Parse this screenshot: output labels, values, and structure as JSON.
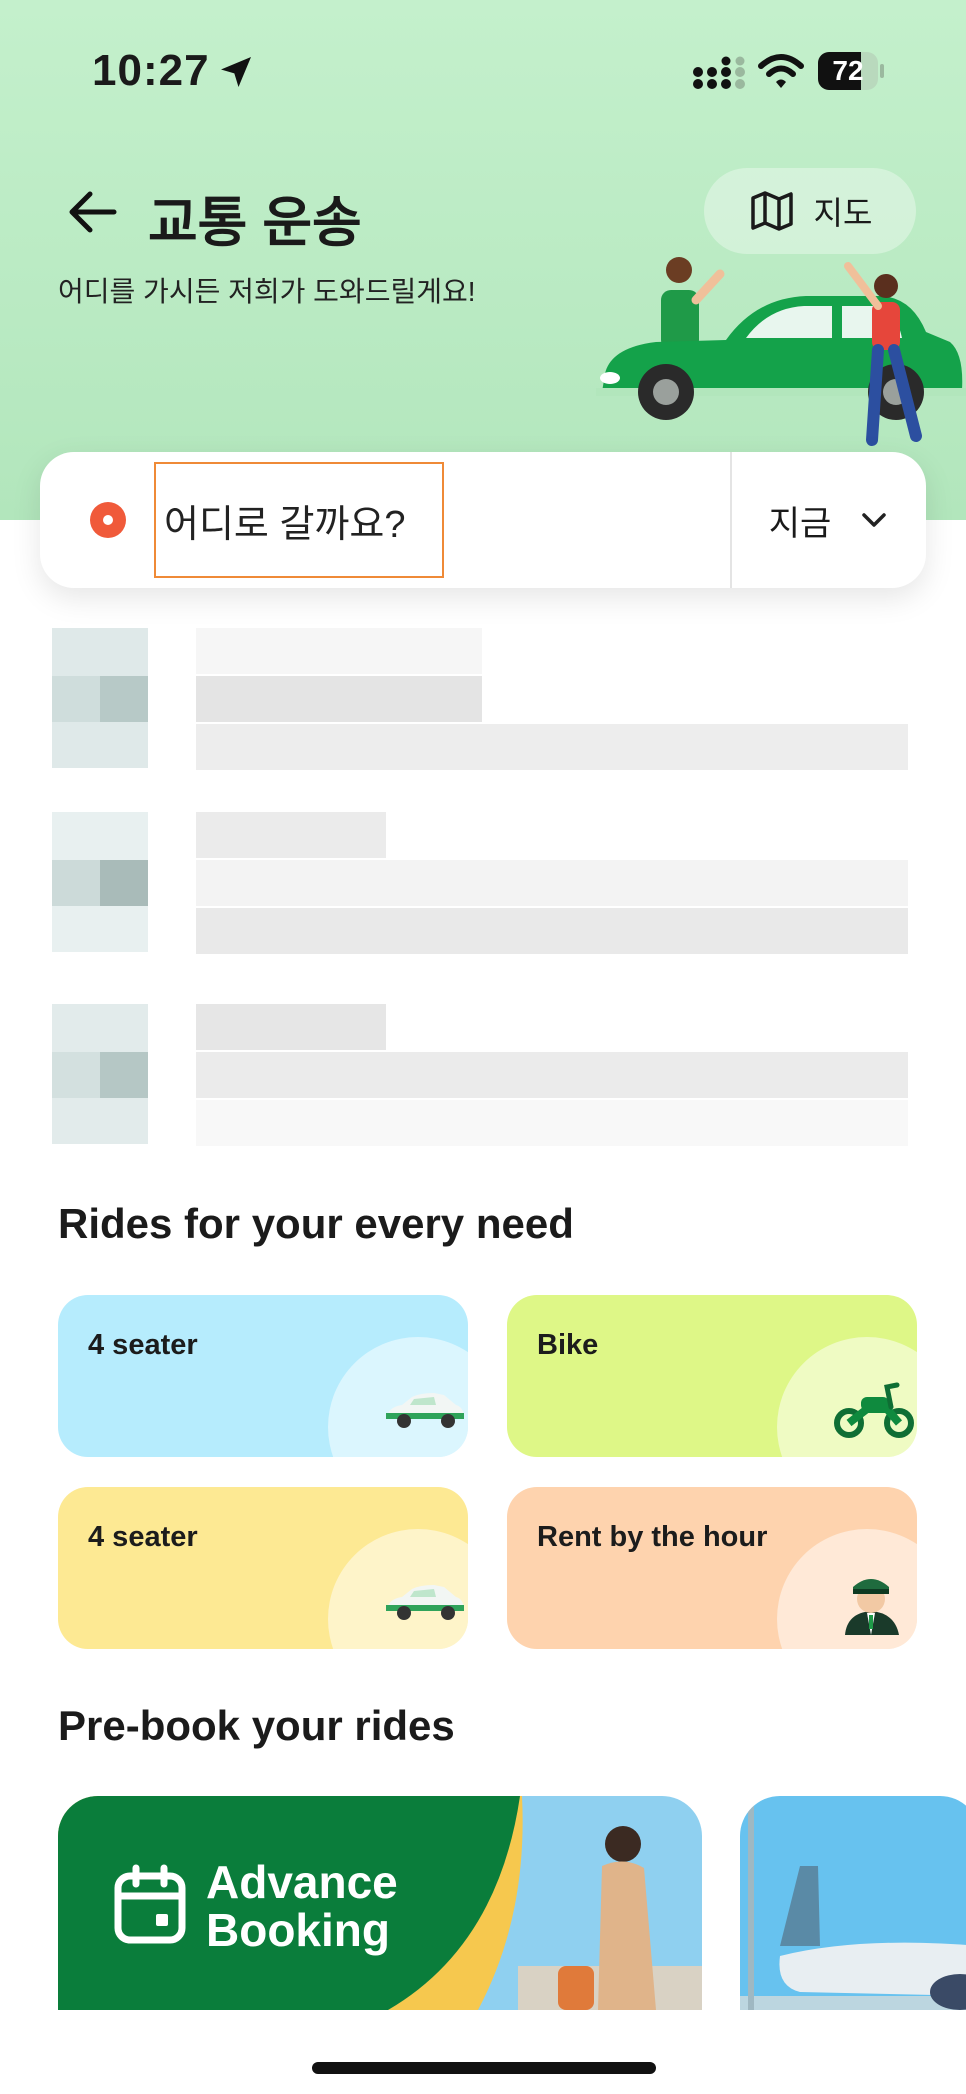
{
  "status_bar": {
    "time": "10:27",
    "battery": "72",
    "battery_level": 0.72
  },
  "header": {
    "title": "교통 운송",
    "subtitle": "어디를 가시든 저희가 도와드릴게요!",
    "map_button_label": "지도"
  },
  "search": {
    "placeholder": "어디로 갈까요?",
    "time_option": "지금"
  },
  "rides_section": {
    "title": "Rides for your every need",
    "options": [
      {
        "label": "4 seater",
        "color": "#b6ecfd",
        "icon": "car-icon"
      },
      {
        "label": "Bike",
        "color": "#def787",
        "icon": "scooter-icon"
      },
      {
        "label": "4 seater",
        "color": "#fde993",
        "icon": "car-icon"
      },
      {
        "label": "Rent by the hour",
        "color": "#fed3ae",
        "icon": "driver-icon"
      }
    ]
  },
  "prebook_section": {
    "title": "Pre-book your rides",
    "banner_line1": "Advance",
    "banner_line2": "Booking"
  },
  "colors": {
    "header_bg": "#c4f0cc",
    "accent_green": "#0a8a3d",
    "pin": "#f05a3a",
    "focus_border": "#ef8a37"
  }
}
